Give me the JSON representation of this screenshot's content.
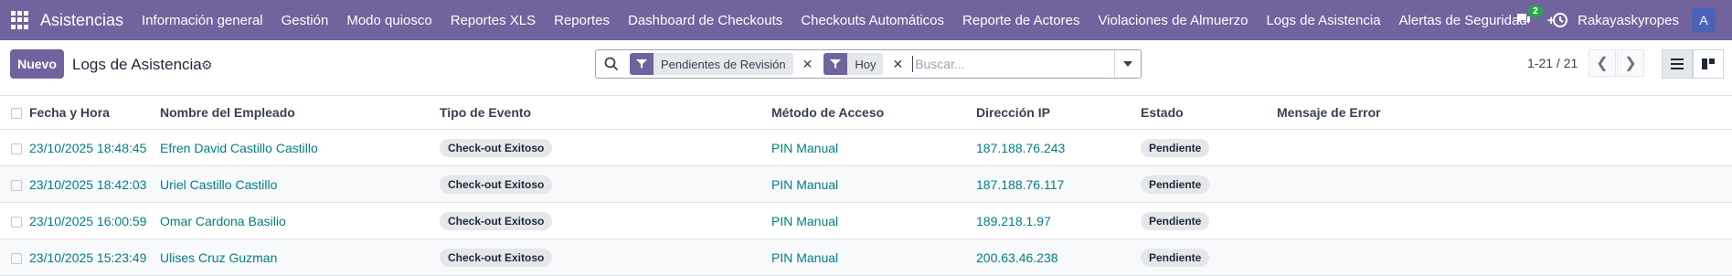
{
  "nav": {
    "brand": "Asistencias",
    "items": [
      "Información general",
      "Gestión",
      "Modo quiosco",
      "Reportes XLS",
      "Reportes",
      "Dashboard de Checkouts",
      "Checkouts Automáticos",
      "Reporte de Actores",
      "Violaciones de Almuerzo",
      "Logs de Asistencia",
      "Alertas de Seguridad"
    ],
    "plus": "+",
    "chat_count": "2",
    "user": "Rakayaskyropes",
    "avatar_letter": "A"
  },
  "control": {
    "new_label": "Nuevo",
    "title": "Logs de Asistencia",
    "facets": [
      "Pendientes de Revisión",
      "Hoy"
    ],
    "search_placeholder": "Buscar...",
    "pager": "1-21 / 21"
  },
  "table": {
    "headers": [
      "Fecha y Hora",
      "Nombre del Empleado",
      "Tipo de Evento",
      "Método de Acceso",
      "Dirección IP",
      "Estado",
      "Mensaje de Error"
    ],
    "rows": [
      {
        "fecha": "23/10/2025 18:48:45",
        "nombre": "Efren David Castillo Castillo",
        "tipo": "Check-out Exitoso",
        "metodo": "PIN Manual",
        "ip": "187.188.76.243",
        "estado": "Pendiente",
        "error": ""
      },
      {
        "fecha": "23/10/2025 18:42:03",
        "nombre": "Uriel Castillo Castillo",
        "tipo": "Check-out Exitoso",
        "metodo": "PIN Manual",
        "ip": "187.188.76.117",
        "estado": "Pendiente",
        "error": ""
      },
      {
        "fecha": "23/10/2025 16:00:59",
        "nombre": "Omar Cardona Basilio",
        "tipo": "Check-out Exitoso",
        "metodo": "PIN Manual",
        "ip": "189.218.1.97",
        "estado": "Pendiente",
        "error": ""
      },
      {
        "fecha": "23/10/2025 15:23:49",
        "nombre": "Ulises Cruz Guzman",
        "tipo": "Check-out Exitoso",
        "metodo": "PIN Manual",
        "ip": "200.63.46.238",
        "estado": "Pendiente",
        "error": ""
      }
    ]
  },
  "colors": {
    "brand": "#71639e",
    "link": "#017e84"
  },
  "icons": [
    "apps-grid-icon",
    "chat-icon",
    "clock-icon",
    "gear-icon",
    "search-icon",
    "filter-icon",
    "close-icon",
    "chevron-down-icon",
    "list-view-icon",
    "kanban-view-icon"
  ]
}
